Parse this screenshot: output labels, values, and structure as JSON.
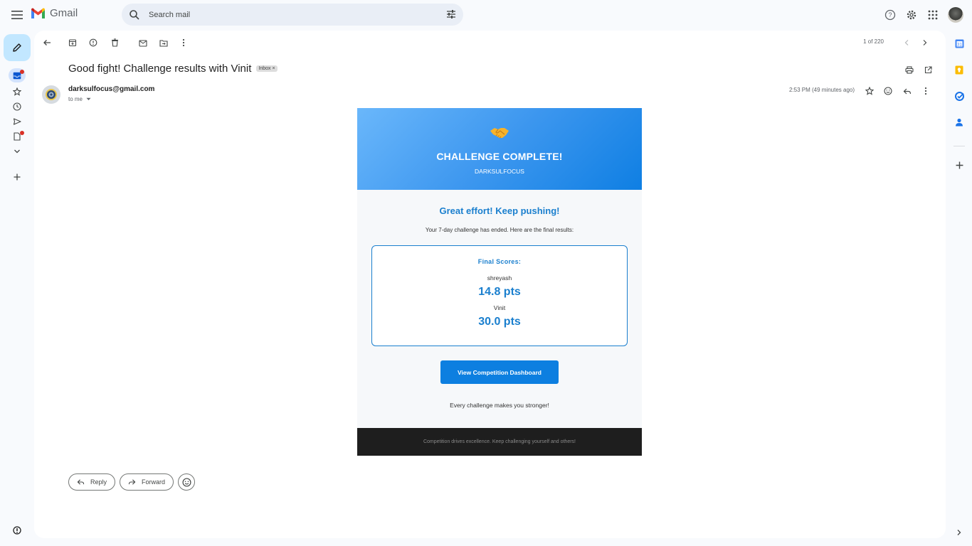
{
  "app": {
    "name": "Gmail"
  },
  "search": {
    "placeholder": "Search mail"
  },
  "toolbar": {
    "pager": "1 of 220"
  },
  "message": {
    "subject": "Good fight! Challenge results with Vinit",
    "label": "Inbox",
    "label_close": "×",
    "sender": "darksulfocus@gmail.com",
    "to": "to me",
    "timestamp": "2:53 PM (49 minutes ago)"
  },
  "email": {
    "emoji": "🤝",
    "heading": "CHALLENGE COMPLETE!",
    "subheading": "DARKSULFOCUS",
    "tagline": "Great effort! Keep pushing!",
    "intro": "Your 7-day challenge has ended. Here are the final results:",
    "scores_title": "Final Scores:",
    "players": [
      {
        "name": "shreyash",
        "score": "14.8 pts"
      },
      {
        "name": "Vinit",
        "score": "30.0 pts"
      }
    ],
    "cta_label": "View Competition Dashboard",
    "closing": "Every challenge makes you stronger!",
    "footer": "Competition drives excellence. Keep challenging yourself and others!"
  },
  "actions": {
    "reply": "Reply",
    "forward": "Forward"
  },
  "colors": {
    "accent": "#1a7fce",
    "cta": "#0d7fe0",
    "compose_bg": "#c2e7ff",
    "footer_bg": "#1e1e1e"
  }
}
